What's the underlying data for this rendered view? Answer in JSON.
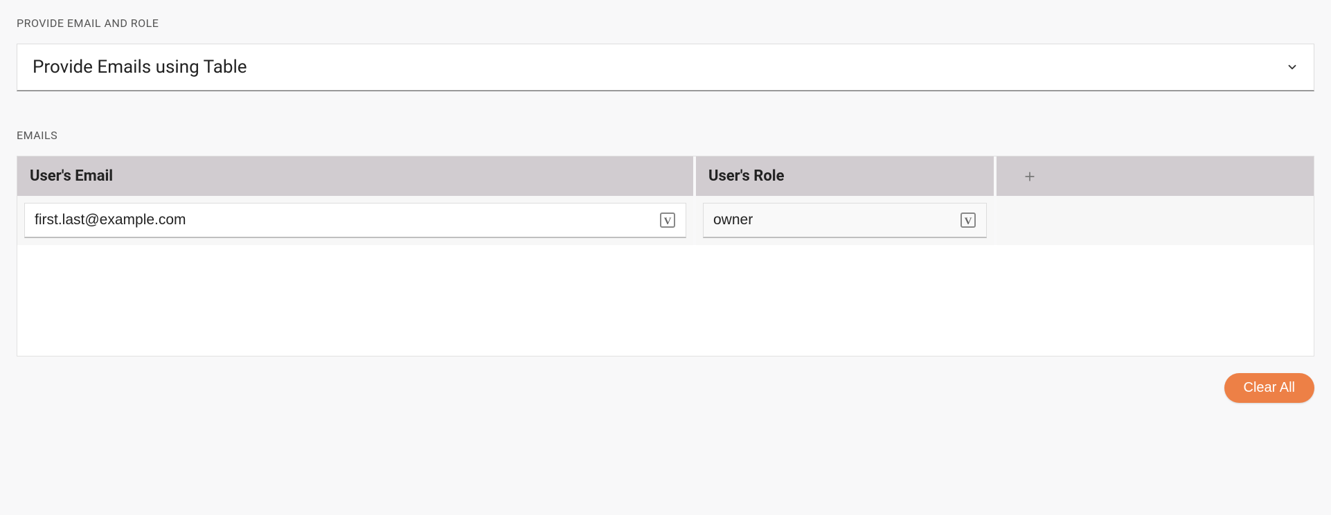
{
  "labels": {
    "section_label": "PROVIDE EMAIL AND ROLE",
    "emails_label": "EMAILS"
  },
  "select": {
    "value": "Provide Emails using Table"
  },
  "table": {
    "headers": {
      "email": "User's Email",
      "role": "User's Role"
    },
    "rows": [
      {
        "email": "first.last@example.com",
        "role": "owner"
      }
    ]
  },
  "buttons": {
    "clear_all": "Clear All"
  }
}
